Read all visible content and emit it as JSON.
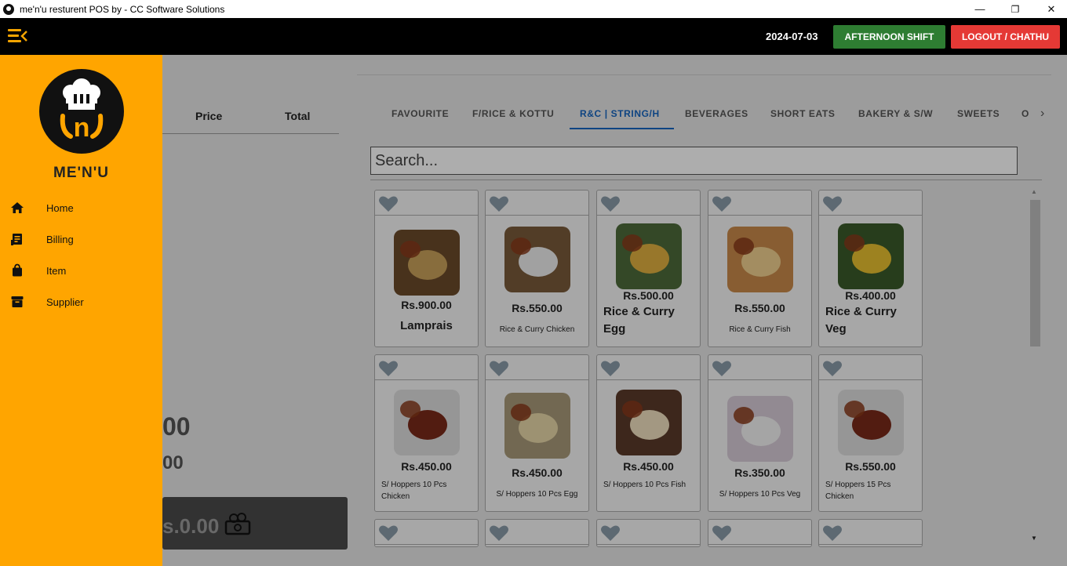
{
  "window": {
    "title": "me'n'u resturent POS by - CC Software Solutions",
    "minimize": "—",
    "restore": "❐",
    "close": "✕"
  },
  "header": {
    "date": "2024-07-03",
    "shift_label": "AFTERNOON SHIFT",
    "logout_label": "LOGOUT / CHATHU",
    "shift_color": "#2e7d32",
    "logout_color": "#e53935",
    "accent": "#ffa500"
  },
  "sidebar": {
    "brand": "ME'N'U",
    "logo_letter": "n",
    "items": [
      {
        "label": "Home",
        "icon": "home-icon"
      },
      {
        "label": "Billing",
        "icon": "receipt-icon"
      },
      {
        "label": "Item",
        "icon": "bag-icon"
      },
      {
        "label": "Supplier",
        "icon": "archive-icon"
      }
    ]
  },
  "order": {
    "col_price": "Price",
    "col_total": "Total",
    "partial_total_1": "00",
    "partial_total_2": "00",
    "pay_amount": "s.0.00"
  },
  "tabs": [
    "FAVOURITE",
    "F/RICE & KOTTU",
    "R&C | STRING/H",
    "BEVERAGES",
    "SHORT EATS",
    "BAKERY & S/W",
    "SWEETS",
    "O"
  ],
  "active_tab": "R&C | STRING/H",
  "search": {
    "placeholder": "Search..."
  },
  "items": [
    {
      "price": "Rs.900.00",
      "name": "Lamprais"
    },
    {
      "price": "Rs.550.00",
      "name": "Rice & Curry Chicken"
    },
    {
      "price": "Rs.500.00",
      "name": "Rice & Curry Egg"
    },
    {
      "price": "Rs.550.00",
      "name": "Rice & Curry Fish"
    },
    {
      "price": "Rs.400.00",
      "name": "Rice & Curry Veg"
    },
    {
      "price": "Rs.450.00",
      "name": "S/ Hoppers 10 Pcs Chicken"
    },
    {
      "price": "Rs.450.00",
      "name": "S/ Hoppers 10 Pcs Egg"
    },
    {
      "price": "Rs.450.00",
      "name": "S/ Hoppers 10 Pcs Fish"
    },
    {
      "price": "Rs.350.00",
      "name": "S/ Hoppers 10 Pcs Veg"
    },
    {
      "price": "Rs.550.00",
      "name": "S/ Hoppers 15 Pcs Chicken"
    }
  ]
}
